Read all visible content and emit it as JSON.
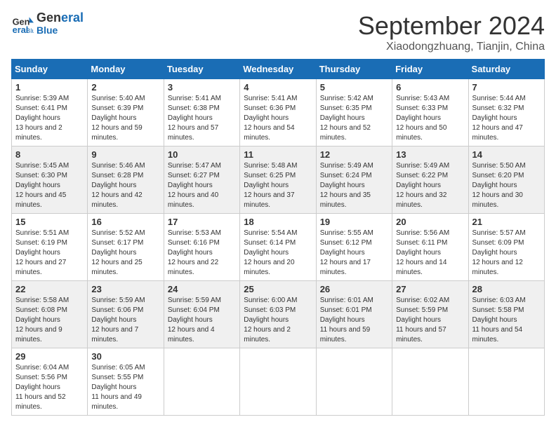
{
  "header": {
    "logo_line1": "General",
    "logo_line2": "Blue",
    "month": "September 2024",
    "location": "Xiaodongzhuang, Tianjin, China"
  },
  "weekdays": [
    "Sunday",
    "Monday",
    "Tuesday",
    "Wednesday",
    "Thursday",
    "Friday",
    "Saturday"
  ],
  "weeks": [
    [
      {
        "day": "1",
        "sunrise": "5:39 AM",
        "sunset": "6:41 PM",
        "daylight": "13 hours and 2 minutes."
      },
      {
        "day": "2",
        "sunrise": "5:40 AM",
        "sunset": "6:39 PM",
        "daylight": "12 hours and 59 minutes."
      },
      {
        "day": "3",
        "sunrise": "5:41 AM",
        "sunset": "6:38 PM",
        "daylight": "12 hours and 57 minutes."
      },
      {
        "day": "4",
        "sunrise": "5:41 AM",
        "sunset": "6:36 PM",
        "daylight": "12 hours and 54 minutes."
      },
      {
        "day": "5",
        "sunrise": "5:42 AM",
        "sunset": "6:35 PM",
        "daylight": "12 hours and 52 minutes."
      },
      {
        "day": "6",
        "sunrise": "5:43 AM",
        "sunset": "6:33 PM",
        "daylight": "12 hours and 50 minutes."
      },
      {
        "day": "7",
        "sunrise": "5:44 AM",
        "sunset": "6:32 PM",
        "daylight": "12 hours and 47 minutes."
      }
    ],
    [
      {
        "day": "8",
        "sunrise": "5:45 AM",
        "sunset": "6:30 PM",
        "daylight": "12 hours and 45 minutes."
      },
      {
        "day": "9",
        "sunrise": "5:46 AM",
        "sunset": "6:28 PM",
        "daylight": "12 hours and 42 minutes."
      },
      {
        "day": "10",
        "sunrise": "5:47 AM",
        "sunset": "6:27 PM",
        "daylight": "12 hours and 40 minutes."
      },
      {
        "day": "11",
        "sunrise": "5:48 AM",
        "sunset": "6:25 PM",
        "daylight": "12 hours and 37 minutes."
      },
      {
        "day": "12",
        "sunrise": "5:49 AM",
        "sunset": "6:24 PM",
        "daylight": "12 hours and 35 minutes."
      },
      {
        "day": "13",
        "sunrise": "5:49 AM",
        "sunset": "6:22 PM",
        "daylight": "12 hours and 32 minutes."
      },
      {
        "day": "14",
        "sunrise": "5:50 AM",
        "sunset": "6:20 PM",
        "daylight": "12 hours and 30 minutes."
      }
    ],
    [
      {
        "day": "15",
        "sunrise": "5:51 AM",
        "sunset": "6:19 PM",
        "daylight": "12 hours and 27 minutes."
      },
      {
        "day": "16",
        "sunrise": "5:52 AM",
        "sunset": "6:17 PM",
        "daylight": "12 hours and 25 minutes."
      },
      {
        "day": "17",
        "sunrise": "5:53 AM",
        "sunset": "6:16 PM",
        "daylight": "12 hours and 22 minutes."
      },
      {
        "day": "18",
        "sunrise": "5:54 AM",
        "sunset": "6:14 PM",
        "daylight": "12 hours and 20 minutes."
      },
      {
        "day": "19",
        "sunrise": "5:55 AM",
        "sunset": "6:12 PM",
        "daylight": "12 hours and 17 minutes."
      },
      {
        "day": "20",
        "sunrise": "5:56 AM",
        "sunset": "6:11 PM",
        "daylight": "12 hours and 14 minutes."
      },
      {
        "day": "21",
        "sunrise": "5:57 AM",
        "sunset": "6:09 PM",
        "daylight": "12 hours and 12 minutes."
      }
    ],
    [
      {
        "day": "22",
        "sunrise": "5:58 AM",
        "sunset": "6:08 PM",
        "daylight": "12 hours and 9 minutes."
      },
      {
        "day": "23",
        "sunrise": "5:59 AM",
        "sunset": "6:06 PM",
        "daylight": "12 hours and 7 minutes."
      },
      {
        "day": "24",
        "sunrise": "5:59 AM",
        "sunset": "6:04 PM",
        "daylight": "12 hours and 4 minutes."
      },
      {
        "day": "25",
        "sunrise": "6:00 AM",
        "sunset": "6:03 PM",
        "daylight": "12 hours and 2 minutes."
      },
      {
        "day": "26",
        "sunrise": "6:01 AM",
        "sunset": "6:01 PM",
        "daylight": "11 hours and 59 minutes."
      },
      {
        "day": "27",
        "sunrise": "6:02 AM",
        "sunset": "5:59 PM",
        "daylight": "11 hours and 57 minutes."
      },
      {
        "day": "28",
        "sunrise": "6:03 AM",
        "sunset": "5:58 PM",
        "daylight": "11 hours and 54 minutes."
      }
    ],
    [
      {
        "day": "29",
        "sunrise": "6:04 AM",
        "sunset": "5:56 PM",
        "daylight": "11 hours and 52 minutes."
      },
      {
        "day": "30",
        "sunrise": "6:05 AM",
        "sunset": "5:55 PM",
        "daylight": "11 hours and 49 minutes."
      },
      null,
      null,
      null,
      null,
      null
    ]
  ]
}
